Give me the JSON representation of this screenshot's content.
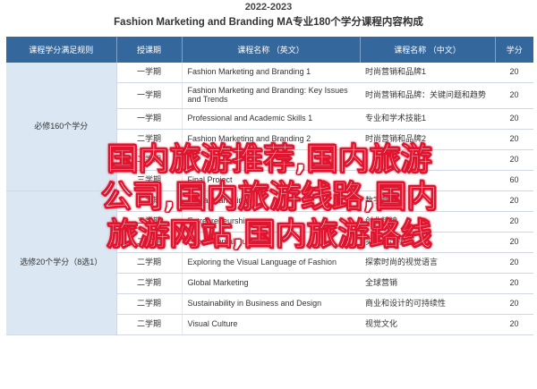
{
  "header": {
    "year": "2022-2023",
    "title": "Fashion Marketing and Branding MA专业180个学分课程内容构成"
  },
  "table": {
    "columns": [
      "课程学分满足规则",
      "授课期",
      "课程名称 （英文）",
      "课程名称 （中文）",
      "学分"
    ],
    "groups": [
      {
        "label": "必修160个学分",
        "rows": [
          {
            "sem": "一学期",
            "en": "Fashion Marketing and Branding 1",
            "cn": "时尚营销和品牌1",
            "cr": "20"
          },
          {
            "sem": "一学期",
            "en": "Fashion Marketing and Branding: Key Issues and Trends",
            "cn": "时尚营销和品牌：关键问题和趋势",
            "cr": "20"
          },
          {
            "sem": "一学期",
            "en": "Professional and Academic Skills 1",
            "cn": "专业和学术技能1",
            "cr": "20"
          },
          {
            "sem": "二学期",
            "en": "Fashion Marketing and Branding 2",
            "cn": "时尚营销和品牌2",
            "cr": "20"
          },
          {
            "sem": "二学期",
            "en": "",
            "cn": "",
            "cr": "20"
          },
          {
            "sem": "三学期",
            "en": "Final Project",
            "cn": "",
            "cr": "60"
          }
        ]
      },
      {
        "label": "选修20个学分（8选1）",
        "rows": [
          {
            "sem": "二学期",
            "en": "Digital Marketing",
            "cn": "数字营销",
            "cr": "20"
          },
          {
            "sem": "二学期",
            "en": "Entrepreneurship",
            "cn": "创业精神",
            "cr": "20"
          },
          {
            "sem": "二学期",
            "en": "Experimental Publishing",
            "cn": "实验性出版",
            "cr": "20"
          },
          {
            "sem": "二学期",
            "en": "Exploring the Visual Language of Fashion",
            "cn": "探索时尚的视觉语言",
            "cr": "20"
          },
          {
            "sem": "二学期",
            "en": "Global Marketing",
            "cn": "全球营销",
            "cr": "20"
          },
          {
            "sem": "二学期",
            "en": "Sustainability in Business and Design",
            "cn": "商业和设计的可持续性",
            "cr": "20"
          },
          {
            "sem": "二学期",
            "en": "Visual Culture",
            "cn": "视觉文化",
            "cr": "20"
          }
        ]
      }
    ]
  },
  "overlay_text": "国内旅游推荐,国内旅游公司,国内旅游线路,国内旅游网站,国内旅游路线"
}
